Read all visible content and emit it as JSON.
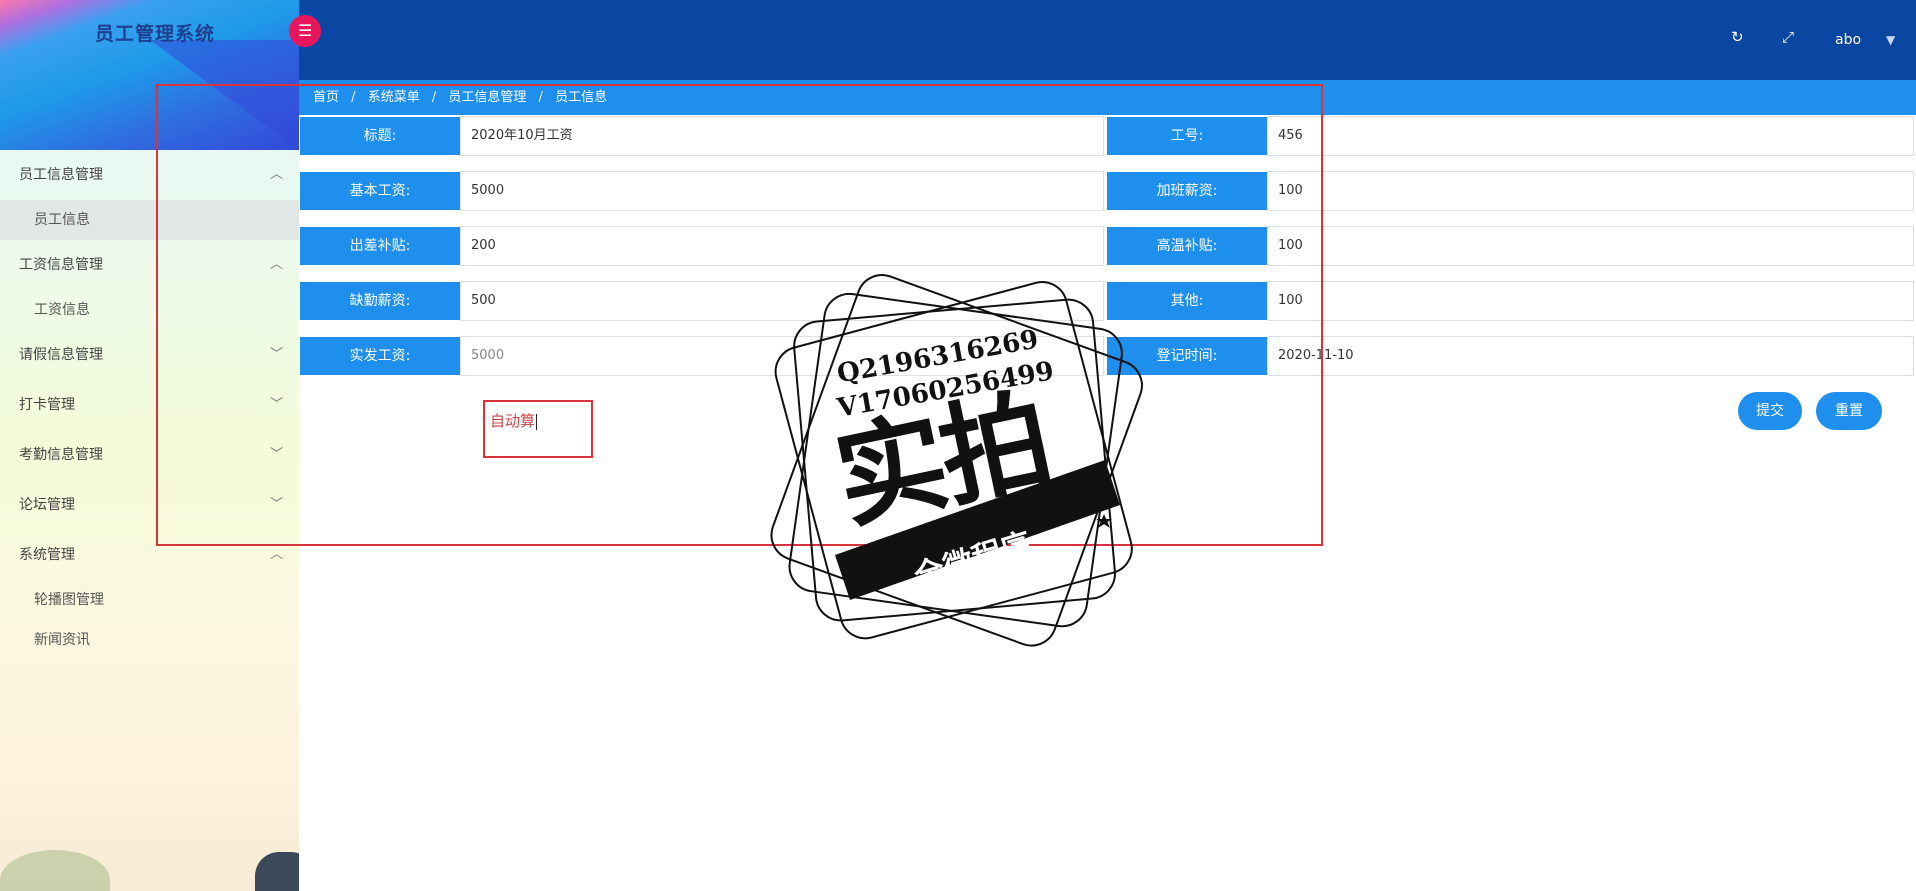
{
  "app": {
    "title": "员工管理系统"
  },
  "header": {
    "menu_toggle_icon": "menu-fold-icon",
    "refresh_icon": "refresh-icon",
    "fullscreen_icon": "fullscreen-icon",
    "user_name": "abo",
    "user_caret_icon": "caret-down-icon"
  },
  "sidebar": {
    "groups": [
      {
        "label": "员工信息管理",
        "expanded": true,
        "items": [
          {
            "label": "员工信息",
            "active": true
          }
        ]
      },
      {
        "label": "工资信息管理",
        "expanded": true,
        "items": [
          {
            "label": "工资信息",
            "active": false
          }
        ]
      },
      {
        "label": "请假信息管理",
        "expanded": false,
        "items": []
      },
      {
        "label": "打卡管理",
        "expanded": false,
        "items": []
      },
      {
        "label": "考勤信息管理",
        "expanded": false,
        "items": []
      },
      {
        "label": "论坛管理",
        "expanded": false,
        "items": []
      },
      {
        "label": "系统管理",
        "expanded": true,
        "items": [
          {
            "label": "轮播图管理",
            "active": false
          },
          {
            "label": "新闻资讯",
            "active": false
          }
        ]
      }
    ]
  },
  "breadcrumb": [
    "首页",
    "系统菜单",
    "员工信息管理",
    "员工信息"
  ],
  "breadcrumb_separator": "/",
  "form": {
    "title_label": "标题:",
    "title_value": "2020年10月工资",
    "emp_no_label": "工号:",
    "emp_no_value": "456",
    "base_salary_label": "基本工资:",
    "base_salary_value": "5000",
    "overtime_label": "加班薪资:",
    "overtime_value": "100",
    "travel_label": "出差补贴:",
    "travel_value": "200",
    "heat_label": "高温补贴:",
    "heat_value": "100",
    "absence_label": "缺勤薪资:",
    "absence_value": "500",
    "other_label": "其他:",
    "other_value": "100",
    "actual_label": "实发工资:",
    "actual_value": "5000",
    "register_time_label": "登记时间:",
    "register_time_value": "2020-11-10",
    "submit_label": "提交",
    "reset_label": "重置"
  },
  "annotation": {
    "note": "自动算"
  },
  "watermark": {
    "line1": "Q2196316269",
    "line2": "V17060256499",
    "big_text": "实拍",
    "ribbon_text": "全微程序"
  },
  "colors": {
    "header_bg": "#0b46a2",
    "accent": "#1e8fec",
    "toggle": "#e8175d",
    "annotation_red": "#d9343a"
  }
}
